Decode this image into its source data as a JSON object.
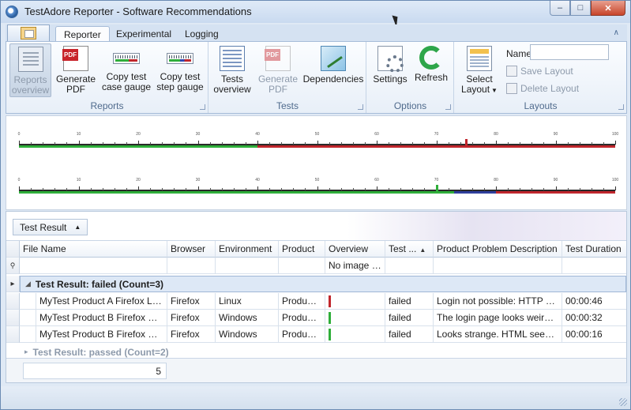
{
  "window": {
    "title": "TestAdore Reporter - Software Recommendations",
    "minimize_symbol": "–",
    "maximize_symbol": "□",
    "close_symbol": "✕"
  },
  "ribbon": {
    "tabs": [
      {
        "label": "Reporter"
      },
      {
        "label": "Experimental"
      },
      {
        "label": "Logging"
      }
    ],
    "collapse_symbol": "∧",
    "groups": {
      "reports": {
        "label": "Reports",
        "buttons": [
          {
            "line1": "Reports",
            "line2": "overview",
            "icon": "report-doc-icon"
          },
          {
            "line1": "Generate",
            "line2": "PDF",
            "icon": "pdf-icon"
          },
          {
            "line1": "Copy test",
            "line2": "case gauge",
            "icon": "gauge-copy-icon"
          },
          {
            "line1": "Copy test",
            "line2": "step gauge",
            "icon": "gauge-copy-icon"
          }
        ]
      },
      "tests": {
        "label": "Tests",
        "buttons": [
          {
            "line1": "Tests",
            "line2": "overview",
            "icon": "tests-doc-icon"
          },
          {
            "line1": "Generate",
            "line2": "PDF",
            "icon": "pdf-icon"
          },
          {
            "line1": "Dependencies",
            "line2": "",
            "icon": "dependencies-icon"
          }
        ]
      },
      "options": {
        "label": "Options",
        "buttons": [
          {
            "line1": "Settings",
            "line2": "",
            "icon": "settings-icon"
          },
          {
            "line1": "Refresh",
            "line2": "",
            "icon": "refresh-icon"
          }
        ]
      },
      "layouts": {
        "label": "Layouts",
        "select_line1": "Select",
        "select_line2": "Layout",
        "dropdown_symbol": "▼",
        "name_label": "Name",
        "name_value": "",
        "save_label": "Save Layout",
        "delete_label": "Delete Layout"
      }
    }
  },
  "gauges": {
    "tick_labels": [
      "0",
      "10",
      "20",
      "30",
      "40",
      "50",
      "60",
      "70",
      "80",
      "90",
      "100"
    ],
    "colors": {
      "passed": "#2fae3a",
      "failed": "#c0262c",
      "other": "#2f3f9c",
      "track": "#222222"
    },
    "test_case_gauge": {
      "scale": [
        0,
        100
      ],
      "segments": [
        {
          "status": "passed",
          "from": 0,
          "to": 40
        },
        {
          "status": "failed",
          "from": 40,
          "to": 100
        }
      ],
      "marker": 75
    },
    "test_step_gauge": {
      "scale": [
        0,
        100
      ],
      "segments": [
        {
          "status": "passed",
          "from": 0,
          "to": 73
        },
        {
          "status": "other",
          "from": 73,
          "to": 80
        },
        {
          "status": "failed",
          "from": 80,
          "to": 100
        }
      ],
      "marker": 70
    }
  },
  "grid": {
    "group_by_chip": "Test Result",
    "group_by_sort_symbol": "▲",
    "columns": [
      "File Name",
      "Browser",
      "Environment",
      "Product",
      "Overview",
      "Test ...",
      "Product Problem Description",
      "Test Duration"
    ],
    "sort_symbol": "▲",
    "filter_row": {
      "overview": "No image data",
      "icon": "filter-pin-icon"
    },
    "groups": [
      {
        "label": "Test Result: failed (Count=3)",
        "expanded": true,
        "rows": [
          {
            "file_name": "MyTest Product A Firefox Linu...",
            "browser": "Firefox",
            "environment": "Linux",
            "product": "Product A",
            "overview_color": "#c0262c",
            "test_result": "failed",
            "description": "Login not possible: HTTP 500 I...",
            "duration": "00:00:46"
          },
          {
            "file_name": "MyTest Product B Firefox Win...",
            "browser": "Firefox",
            "environment": "Windows",
            "product": "Product B",
            "overview_color": "#2fae3a",
            "test_result": "failed",
            "description": "The login page looks weird. Se...",
            "duration": "00:00:32"
          },
          {
            "file_name": "MyTest Product B Firefox Win...",
            "browser": "Firefox",
            "environment": "Windows",
            "product": "Product B",
            "overview_color": "#2fae3a",
            "test_result": "failed",
            "description": "Looks strange. HTML seems b...",
            "duration": "00:00:16"
          }
        ]
      },
      {
        "label": "Test Result: passed (Count=2)",
        "expanded": false,
        "rows": []
      }
    ],
    "footer_count": "5"
  }
}
